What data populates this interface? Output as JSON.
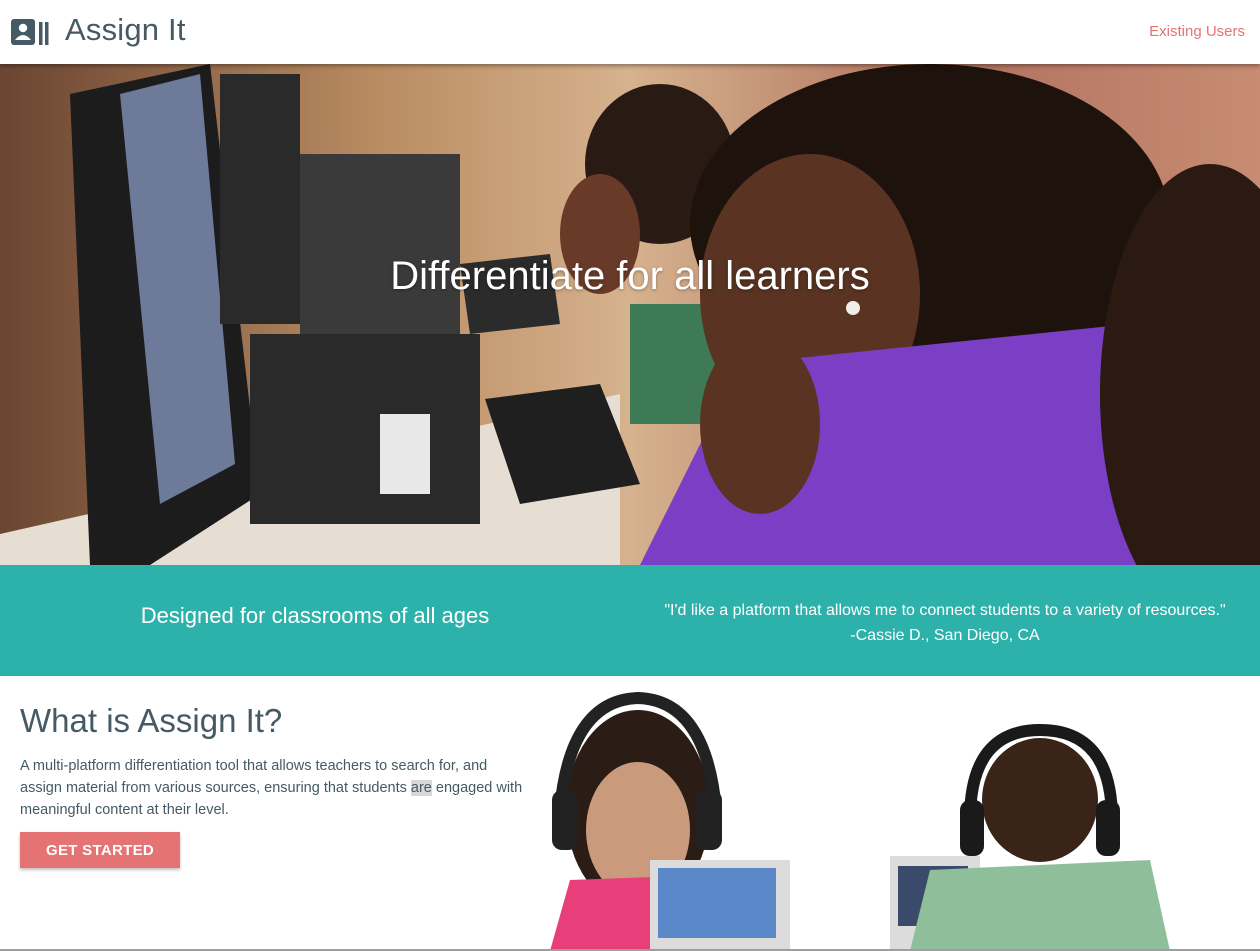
{
  "header": {
    "brand": "Assign It",
    "existing_users": "Existing Users",
    "logo_icon": "contact-card-icon"
  },
  "hero": {
    "title": "Differentiate for all learners",
    "image": "students-at-computers-photo"
  },
  "band": {
    "left_text": "Designed for classrooms of all ages",
    "quote": "\"I'd like a platform that allows me to connect students to a variety of resources.\"",
    "quote_author": "-Cassie D., San Diego, CA"
  },
  "about": {
    "title": "What is Assign It?",
    "text_before": "A multi-platform differentiation tool that allows teachers to search for, and assign material from various sources, ensuring that students ",
    "text_highlight": "are",
    "text_after": " engaged with meaningful content at their level.",
    "cta": "GET STARTED",
    "image": "kids-with-headphones-photo"
  },
  "colors": {
    "accent": "#e57373",
    "teal": "#2db2ab",
    "text": "#455a64"
  }
}
